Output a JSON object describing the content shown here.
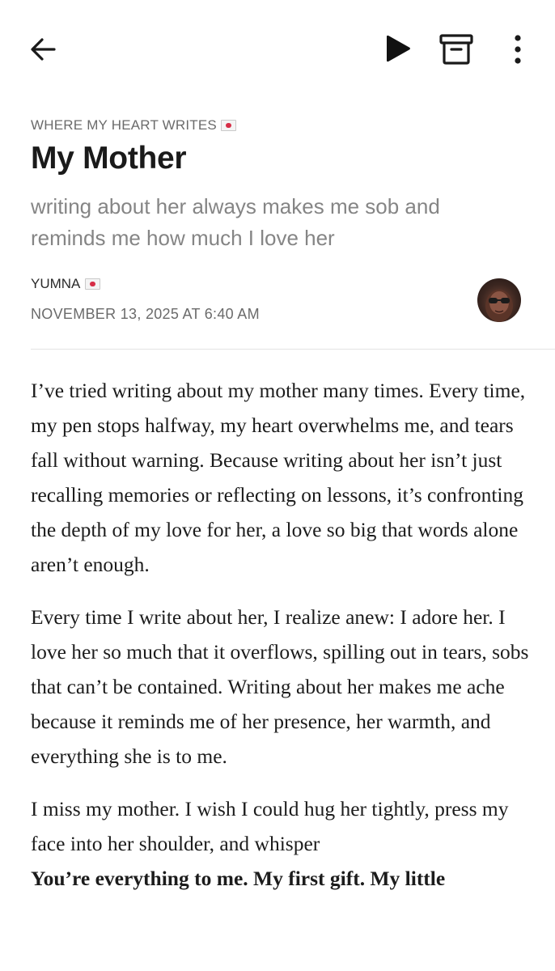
{
  "toolbar": {
    "back_icon": "arrow-left-icon",
    "play_icon": "play-icon",
    "archive_icon": "archive-box-icon",
    "more_icon": "vertical-dots-icon"
  },
  "header": {
    "publication": "WHERE MY HEART WRITES",
    "publication_emoji": "envelope-heart-icon",
    "title": "My Mother",
    "subtitle": "writing about her always makes me sob and reminds me how much I love her",
    "author": "YUMNA",
    "author_emoji": "envelope-heart-icon",
    "date": "NOVEMBER 13, 2025 AT 6:40 AM"
  },
  "article": {
    "paragraphs": [
      "I’ve tried writing about my mother many times. Every time, my pen stops halfway, my heart overwhelms me, and tears fall without warning. Because writing about her isn’t just recalling memories or reflecting on lessons, it’s confronting the depth of my love for her, a love so big that words alone aren’t enough.",
      "Every time I write about her, I realize anew: I adore her. I love her so much that it overflows, spilling out in tears, sobs that can’t be contained. Writing about her makes me ache because it reminds me of her presence, her warmth, and everything she is to me.",
      "I miss my mother. I wish I could hug her tightly, press my face into her shoulder, and whisper"
    ],
    "bold_line": "You’re everything to me. My first gift. My little"
  },
  "colors": {
    "text": "#1a1a1a",
    "muted": "#6b6b6b",
    "subtitle": "#858585",
    "divider": "#e4e4e4",
    "heart": "#d62d46"
  }
}
